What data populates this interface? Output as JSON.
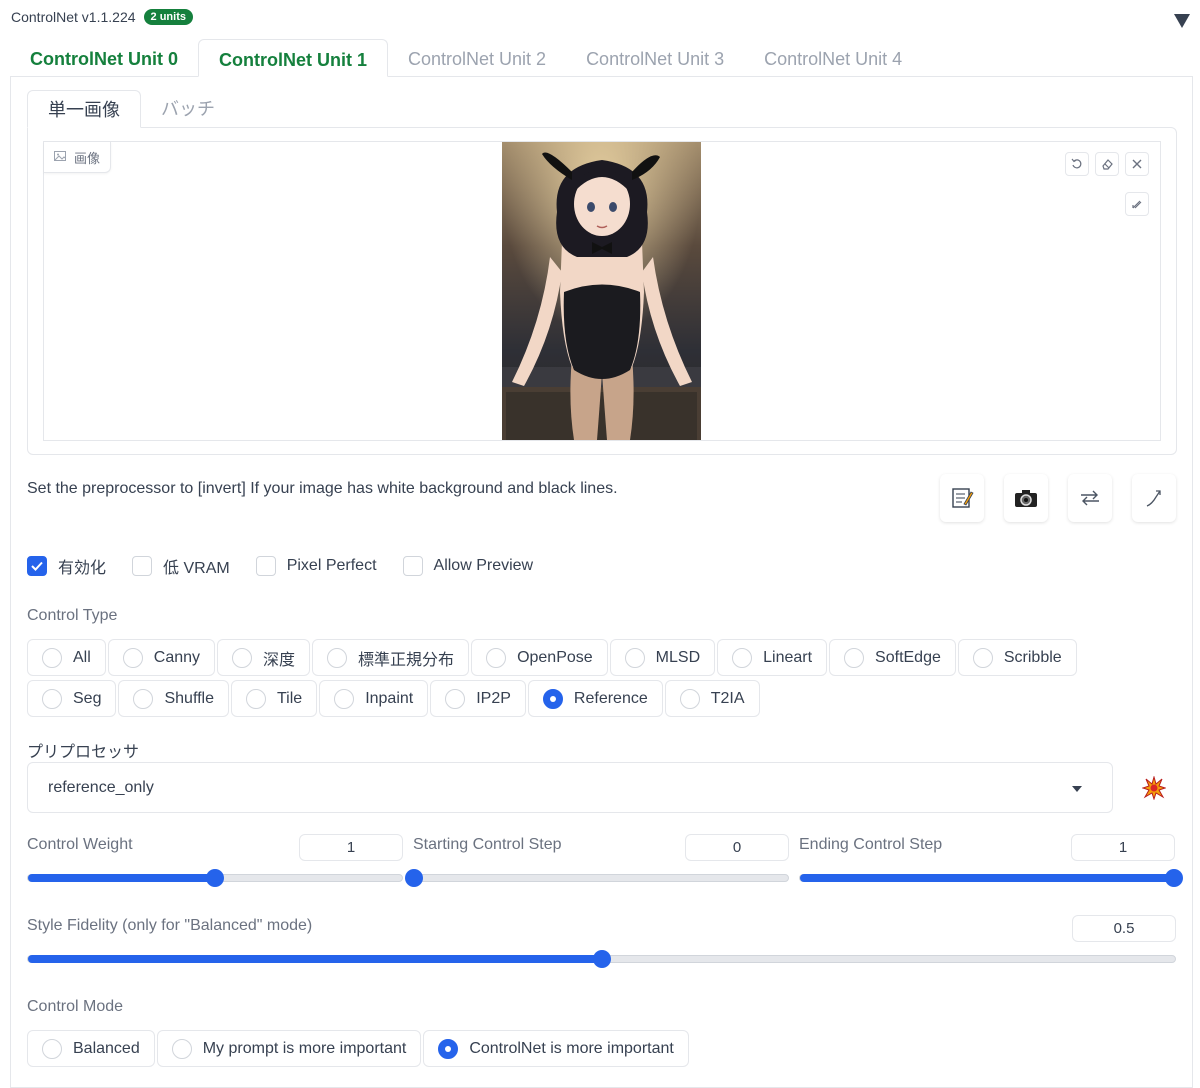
{
  "header": {
    "title": "ControlNet v1.1.224",
    "badge": "2 units"
  },
  "unit_tabs": [
    "ControlNet Unit 0",
    "ControlNet Unit 1",
    "ControlNet Unit 2",
    "ControlNet Unit 3",
    "ControlNet Unit 4"
  ],
  "sub_tabs": [
    "単一画像",
    "バッチ"
  ],
  "image_panel": {
    "label": "画像"
  },
  "info_text": "Set the preprocessor to [invert] If your image has white background and black lines.",
  "checks": [
    {
      "label": "有効化",
      "checked": true
    },
    {
      "label": "低 VRAM",
      "checked": false
    },
    {
      "label": "Pixel Perfect",
      "checked": false
    },
    {
      "label": "Allow Preview",
      "checked": false
    }
  ],
  "control_type": {
    "label": "Control Type",
    "row1": [
      "All",
      "Canny",
      "深度",
      "標準正規分布",
      "OpenPose",
      "MLSD",
      "Lineart",
      "SoftEdge",
      "Scribble"
    ],
    "row2": [
      "Seg",
      "Shuffle",
      "Tile",
      "Inpaint",
      "IP2P",
      "Reference",
      "T2IA"
    ],
    "selected": "Reference"
  },
  "preprocessor": {
    "label": "プリプロセッサ",
    "value": "reference_only"
  },
  "sliders": {
    "control_weight": {
      "label": "Control Weight",
      "value": "1",
      "fraction": 0.5
    },
    "starting_step": {
      "label": "Starting Control Step",
      "value": "0",
      "fraction": 0.0
    },
    "ending_step": {
      "label": "Ending Control Step",
      "value": "1",
      "fraction": 1.0
    },
    "style_fidelity": {
      "label": "Style Fidelity (only for \"Balanced\" mode)",
      "value": "0.5",
      "fraction": 0.5
    }
  },
  "control_mode": {
    "label": "Control Mode",
    "options": [
      "Balanced",
      "My prompt is more important",
      "ControlNet is more important"
    ],
    "selected": "ControlNet is more important"
  },
  "colors": {
    "accent": "#2563eb",
    "tab_green": "#15803d"
  }
}
